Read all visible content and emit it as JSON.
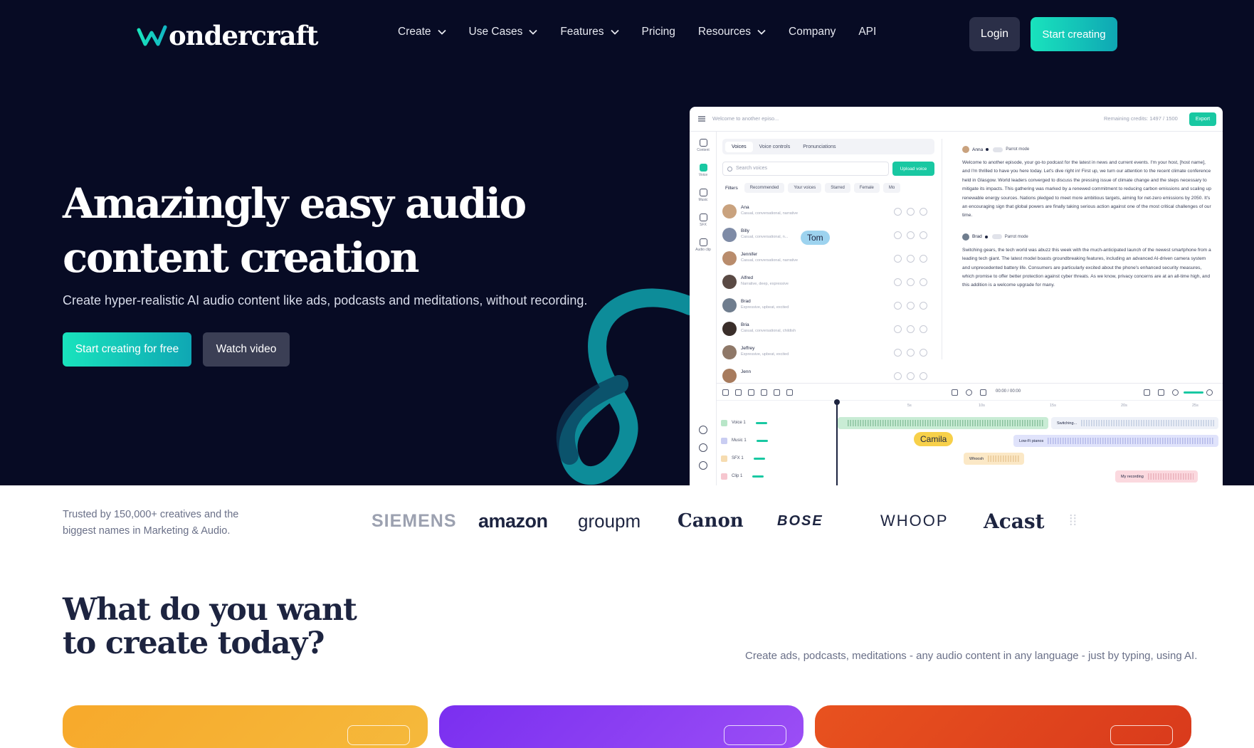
{
  "brand": {
    "name": "ondercraft",
    "mark": "wondercraft-w-logo"
  },
  "nav": {
    "items": [
      {
        "label": "Create",
        "has_dropdown": true
      },
      {
        "label": "Use Cases",
        "has_dropdown": true
      },
      {
        "label": "Features",
        "has_dropdown": true
      },
      {
        "label": "Pricing",
        "has_dropdown": false
      },
      {
        "label": "Resources",
        "has_dropdown": true
      },
      {
        "label": "Company",
        "has_dropdown": false
      },
      {
        "label": "API",
        "has_dropdown": false
      }
    ],
    "login_label": "Login",
    "start_label": "Start creating"
  },
  "hero": {
    "title_line1": "Amazingly easy audio",
    "title_line2": "content creation",
    "subtitle": "Create hyper-realistic AI audio content like ads, podcasts and meditations, without recording.",
    "primary_cta": "Start creating for free",
    "secondary_cta": "Watch video"
  },
  "app": {
    "doc_title": "Welcome to another episo...",
    "credits": "Remaining credits: 1497 / 1500",
    "export_label": "Export",
    "sidebar": [
      "Content",
      "Voice",
      "Music",
      "SFX",
      "Audio clip"
    ],
    "voice_tabs": [
      "Voices",
      "Voice controls",
      "Pronunciations"
    ],
    "search_placeholder": "Search voices",
    "upload_label": "Upload voice",
    "filters_label": "Filters",
    "filter_chips": [
      "Recommended",
      "Your voices",
      "Starred",
      "Female",
      "Mo"
    ],
    "voices": [
      {
        "name": "Ana",
        "desc": "Casual, conversational, narrative",
        "color": "#c9a27e"
      },
      {
        "name": "Billy",
        "desc": "Casual, conversational, n...",
        "color": "#7e8ba6"
      },
      {
        "name": "Jennifer",
        "desc": "Casual, conversational, narrative",
        "color": "#b98c6c"
      },
      {
        "name": "Alfred",
        "desc": "Narrative, deep, expressive",
        "color": "#5a4a44"
      },
      {
        "name": "Brad",
        "desc": "Expressive, upbeat, excited",
        "color": "#6f7d8e"
      },
      {
        "name": "Bria",
        "desc": "Casual, conversational, childish",
        "color": "#3a2e2a"
      },
      {
        "name": "Jeffrey",
        "desc": "Expressive, upbeat, excited",
        "color": "#8f7868"
      },
      {
        "name": "Jenn",
        "desc": "",
        "color": "#a77b5d"
      }
    ],
    "cursor_tom": "Tom",
    "cursor_camila": "Camila",
    "script": [
      {
        "speaker": "Anna",
        "mode": "Parrot mode",
        "text": "Welcome to another episode, your go-to podcast for the latest in news and current events. I'm your host, [host name], and I'm thrilled to have you here today. Let's dive right in! First up, we turn our attention to the recent climate conference held in Glasgow. World leaders converged to discuss the pressing issue of climate change and the steps necessary to mitigate its impacts. This gathering was marked by a renewed commitment to reducing carbon emissions and scaling up renewable energy sources. Nations pledged to meet more ambitious targets, aiming for net-zero emissions by 2050. It's an encouraging sign that global powers are finally taking serious action against one of the most critical challenges of our time."
      },
      {
        "speaker": "Brad",
        "mode": "Parrot mode",
        "text": "Switching gears, the tech world was abuzz this week with the much-anticipated launch of the newest smartphone from a leading tech giant. The latest model boasts groundbreaking features, including an advanced AI-driven camera system and unprecedented battery life. Consumers are particularly excited about the phone's enhanced security measures, which promise to offer better protection against cyber threats. As we know, privacy concerns are at an all-time high, and this addition is a welcome upgrade for many."
      }
    ],
    "timeline": {
      "time": "00:00 / 00:00",
      "ruler": [
        "5s",
        "10s",
        "15s",
        "20s",
        "25s"
      ],
      "tracks": [
        {
          "label": "Voice 1",
          "color": "#b8e6c8"
        },
        {
          "label": "Music 1",
          "color": "#c9cdf2"
        },
        {
          "label": "SFX 1",
          "color": "#f6dcb0"
        },
        {
          "label": "Clip 1",
          "color": "#f6c6cf"
        }
      ],
      "clips": {
        "switching": "Switching...",
        "lofi": "Low-Fi pianos",
        "whoosh": "Whoosh",
        "recording": "My recording"
      }
    }
  },
  "trusted": {
    "text": "Trusted by 150,000+ creatives and the biggest names in Marketing & Audio.",
    "logos": [
      "SIEMENS",
      "amazon",
      "groupm",
      "Canon",
      "BOSE",
      "WHOOP",
      "Acast"
    ]
  },
  "create": {
    "title_line1": "What do you want",
    "title_line2": "to create today?",
    "subtitle": "Create ads, podcasts, meditations - any audio content in any language - just by typing, using AI."
  },
  "colors": {
    "hero_bg": "#070b24",
    "accent": "#19e3bd",
    "accent_dark": "#0fa7b4",
    "card_orange": "#f7a92b",
    "card_purple": "#8b3ff0",
    "card_red": "#e2471c"
  }
}
